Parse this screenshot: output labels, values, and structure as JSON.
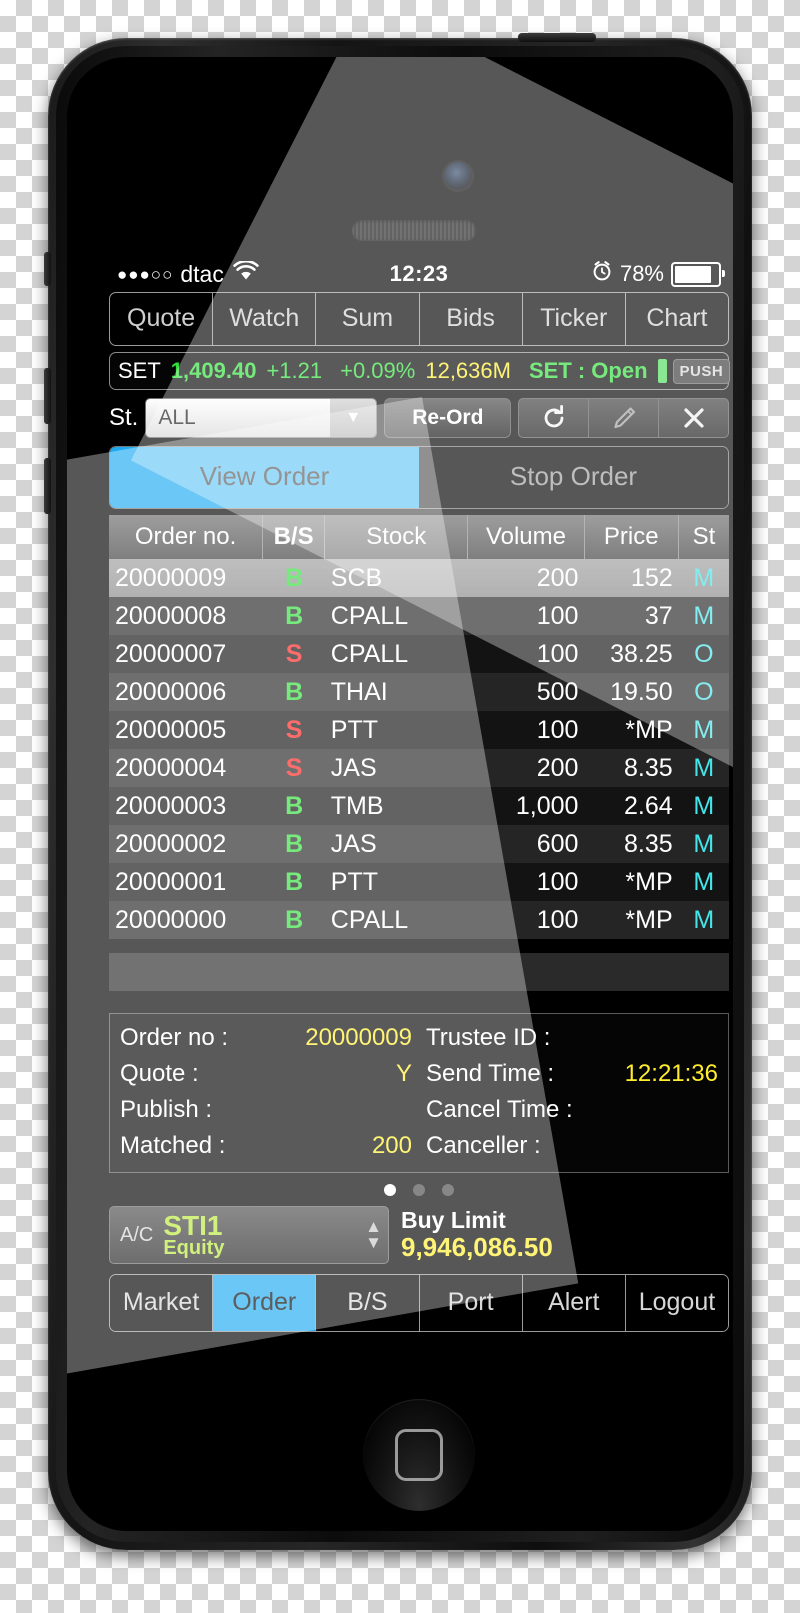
{
  "status_bar": {
    "signal_dots": "●●●○○",
    "carrier": "dtac",
    "wifi_icon": "wifi-icon",
    "time": "12:23",
    "alarm_icon": "alarm-clock-icon",
    "battery_percent": "78%"
  },
  "top_tabs": [
    {
      "label": "Quote"
    },
    {
      "label": "Watch"
    },
    {
      "label": "Sum"
    },
    {
      "label": "Bids"
    },
    {
      "label": "Ticker"
    },
    {
      "label": "Chart"
    }
  ],
  "market_bar": {
    "index_name": "SET",
    "index_value": "1,409.40",
    "change": "+1.21",
    "change_percent": "+0.09%",
    "volume": "12,636M",
    "market_status": "SET : Open",
    "push_badge": "PUSH",
    "colors": {
      "up_green": "#2fe03a",
      "volume_yellow": "#ffee2e",
      "accent_blue": "#1eaaf1"
    }
  },
  "filter_row": {
    "st_label": "St.",
    "status_filter_value": "ALL",
    "dropdown_icon": "chevron-down-icon",
    "reorder_button": "Re-Ord",
    "refresh_icon": "refresh-icon",
    "edit_icon": "pencil-icon",
    "close_icon": "close-x-icon"
  },
  "order_tabs": [
    {
      "label": "View Order",
      "active": true
    },
    {
      "label": "Stop Order",
      "active": false
    }
  ],
  "order_table": {
    "headers": [
      "Order no.",
      "B/S",
      "Stock",
      "Volume",
      "Price",
      "St"
    ],
    "rows": [
      {
        "order_no": "20000009",
        "bs": "B",
        "stock": "SCB",
        "volume": "200",
        "price": "152",
        "st": "M"
      },
      {
        "order_no": "20000008",
        "bs": "B",
        "stock": "CPALL",
        "volume": "100",
        "price": "37",
        "st": "M"
      },
      {
        "order_no": "20000007",
        "bs": "S",
        "stock": "CPALL",
        "volume": "100",
        "price": "38.25",
        "st": "O"
      },
      {
        "order_no": "20000006",
        "bs": "B",
        "stock": "THAI",
        "volume": "500",
        "price": "19.50",
        "st": "O"
      },
      {
        "order_no": "20000005",
        "bs": "S",
        "stock": "PTT",
        "volume": "100",
        "price": "*MP",
        "st": "M"
      },
      {
        "order_no": "20000004",
        "bs": "S",
        "stock": "JAS",
        "volume": "200",
        "price": "8.35",
        "st": "M"
      },
      {
        "order_no": "20000003",
        "bs": "B",
        "stock": "TMB",
        "volume": "1,000",
        "price": "2.64",
        "st": "M"
      },
      {
        "order_no": "20000002",
        "bs": "B",
        "stock": "JAS",
        "volume": "600",
        "price": "8.35",
        "st": "M"
      },
      {
        "order_no": "20000001",
        "bs": "B",
        "stock": "PTT",
        "volume": "100",
        "price": "*MP",
        "st": "M"
      },
      {
        "order_no": "20000000",
        "bs": "B",
        "stock": "CPALL",
        "volume": "100",
        "price": "*MP",
        "st": "M"
      }
    ]
  },
  "detail_panel": {
    "order_no_label": "Order no :",
    "order_no_value": "20000009",
    "trustee_id_label": "Trustee ID :",
    "trustee_id_value": "",
    "quote_label": "Quote :",
    "quote_value": "Y",
    "send_time_label": "Send Time :",
    "send_time_value": "12:21:36",
    "publish_label": "Publish :",
    "publish_value": "",
    "cancel_time_label": "Cancel Time :",
    "cancel_time_value": "",
    "matched_label": "Matched :",
    "matched_value": "200",
    "canceller_label": "Canceller :",
    "canceller_value": ""
  },
  "page_dots": {
    "total": 3,
    "active_index": 0
  },
  "account": {
    "ac_label": "A/C",
    "account_name": "STI1",
    "account_type": "Equity",
    "stepper_up_icon": "stepper-up-icon",
    "stepper_down_icon": "stepper-down-icon",
    "buy_limit_label": "Buy Limit",
    "buy_limit_value": "9,946,086.50"
  },
  "bottom_nav": [
    {
      "label": "Market",
      "active": false
    },
    {
      "label": "Order",
      "active": true
    },
    {
      "label": "B/S",
      "active": false
    },
    {
      "label": "Port",
      "active": false
    },
    {
      "label": "Alert",
      "active": false
    },
    {
      "label": "Logout",
      "active": false
    }
  ],
  "device": {
    "camera_icon": "front-camera-icon",
    "earpiece_icon": "earpiece-speaker-icon",
    "home_button_icon": "home-button-icon"
  }
}
